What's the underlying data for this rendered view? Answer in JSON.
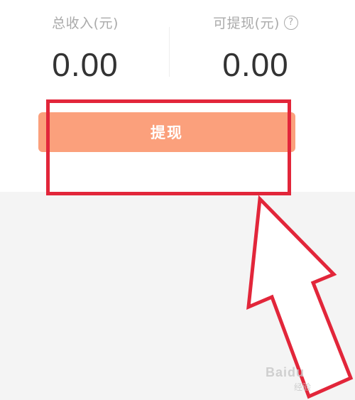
{
  "stats": {
    "total_income": {
      "label": "总收入(元)",
      "value": "0.00"
    },
    "withdrawable": {
      "label": "可提现(元)",
      "value": "0.00",
      "help_icon": "question-circle-icon"
    }
  },
  "withdraw_button": {
    "label": "提现"
  },
  "annotation": {
    "highlight_color": "#e2263a",
    "arrow_color": "#e2263a"
  },
  "watermark": {
    "brand": "Baidu",
    "sub": "经验"
  },
  "colors": {
    "button_bg": "#fba07c",
    "label_gray": "#aaaaaa",
    "value_dark": "#333333",
    "lower_bg": "#f4f4f4"
  }
}
